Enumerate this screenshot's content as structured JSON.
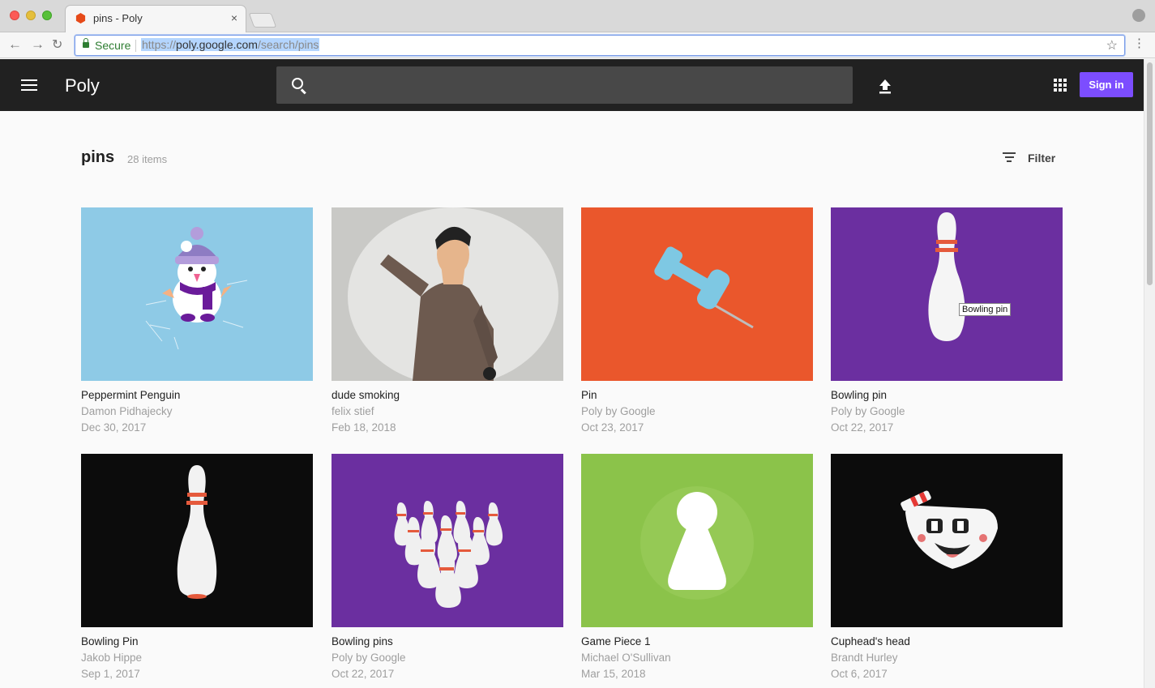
{
  "browser": {
    "tab_title": "pins - Poly",
    "tab_close": "×",
    "secure_label": "Secure",
    "url_scheme": "https://",
    "url_host": "poly.google.com",
    "url_path": "/search/pins",
    "nav_back": "←",
    "nav_forward": "→",
    "nav_reload": "↻",
    "star": "☆",
    "menu": "⋮"
  },
  "appbar": {
    "brand": "Poly",
    "search_value": "",
    "signin_label": "Sign in"
  },
  "header": {
    "query": "pins",
    "count": "28 items",
    "filter_label": "Filter"
  },
  "cards": [
    {
      "title": "Peppermint Penguin",
      "author": "Damon Pidhajecky",
      "date": "Dec 30, 2017",
      "bg": "#8ecae6"
    },
    {
      "title": "dude smoking",
      "author": "felix stief",
      "date": "Feb 18, 2018",
      "bg": "#c9c9c6"
    },
    {
      "title": "Pin",
      "author": "Poly by Google",
      "date": "Oct 23, 2017",
      "bg": "#ea572c"
    },
    {
      "title": "Bowling pin",
      "author": "Poly by Google",
      "date": "Oct 22, 2017",
      "bg": "#6b2fa0",
      "tooltip": "Bowling pin"
    },
    {
      "title": "Bowling Pin",
      "author": "Jakob Hippe",
      "date": "Sep 1, 2017",
      "bg": "#0c0c0c"
    },
    {
      "title": "Bowling pins",
      "author": "Poly by Google",
      "date": "Oct 22, 2017",
      "bg": "#6b2fa0"
    },
    {
      "title": "Game Piece 1",
      "author": "Michael O'Sullivan",
      "date": "Mar 15, 2018",
      "bg": "#8bc34a"
    },
    {
      "title": "Cuphead's head",
      "author": "Brandt Hurley",
      "date": "Oct 6, 2017",
      "bg": "#0c0c0c"
    }
  ],
  "colors": {
    "appbar": "#212121",
    "accent": "#7c4dff",
    "secure": "#2e7d32"
  },
  "icons": [
    "hamburger-icon",
    "search-icon",
    "upload-icon",
    "apps-icon",
    "filter-icon",
    "lock-icon",
    "star-icon"
  ]
}
